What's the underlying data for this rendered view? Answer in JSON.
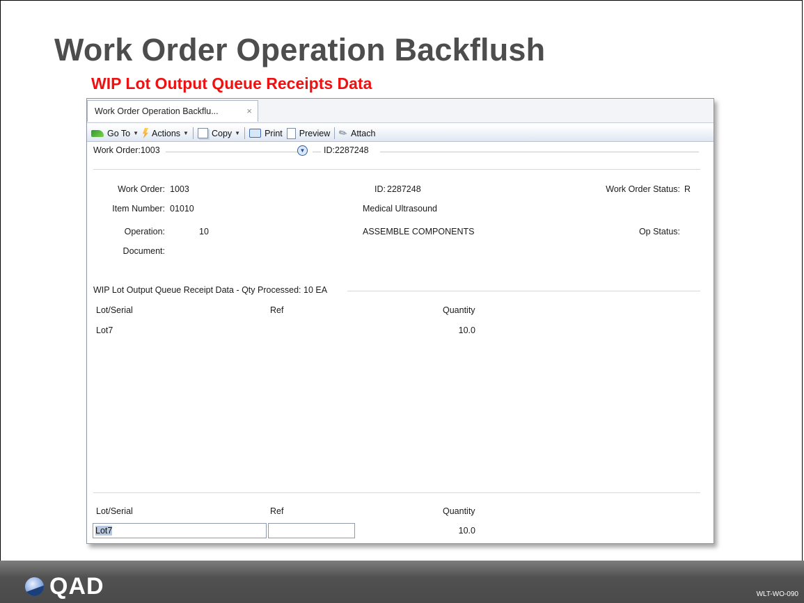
{
  "slide": {
    "title": "Work Order Operation Backflush",
    "subtitle": "WIP Lot Output Queue Receipts Data",
    "code": "WLT-WO-090"
  },
  "logo": {
    "text": "QAD"
  },
  "window": {
    "tab": {
      "label": "Work Order Operation Backflu...",
      "close_icon": "×"
    },
    "toolbar": {
      "goto_label": "Go To",
      "actions_label": "Actions",
      "copy_label": "Copy",
      "print_label": "Print",
      "preview_label": "Preview",
      "attach_label": "Attach"
    },
    "header": {
      "work_order": "Work Order:1003",
      "expand_icon": "chevron-down-circle",
      "id": "ID:2287248"
    },
    "details": {
      "work_order_label": "Work Order:",
      "work_order_value": "1003",
      "id_label": "ID:",
      "id_value": "2287248",
      "status_label": "Work Order Status:",
      "status_value": "R",
      "item_label": "Item Number:",
      "item_value": "01010",
      "item_desc": "Medical Ultrasound",
      "operation_label": "Operation:",
      "operation_value": "10",
      "operation_desc": "ASSEMBLE COMPONENTS",
      "op_status_label": "Op Status:",
      "document_label": "Document:"
    },
    "queue": {
      "title": "WIP Lot Output Queue Receipt Data - Qty Processed: 10 EA",
      "columns": {
        "lot": "Lot/Serial",
        "ref": "Ref",
        "qty": "Quantity"
      },
      "rows": [
        {
          "lot": "Lot7",
          "ref": "",
          "qty": "10.0"
        }
      ]
    },
    "edit": {
      "columns": {
        "lot": "Lot/Serial",
        "ref": "Ref",
        "qty": "Quantity"
      },
      "lot_value": "Lot7",
      "ref_value": "",
      "qty_value": "10.0"
    }
  }
}
